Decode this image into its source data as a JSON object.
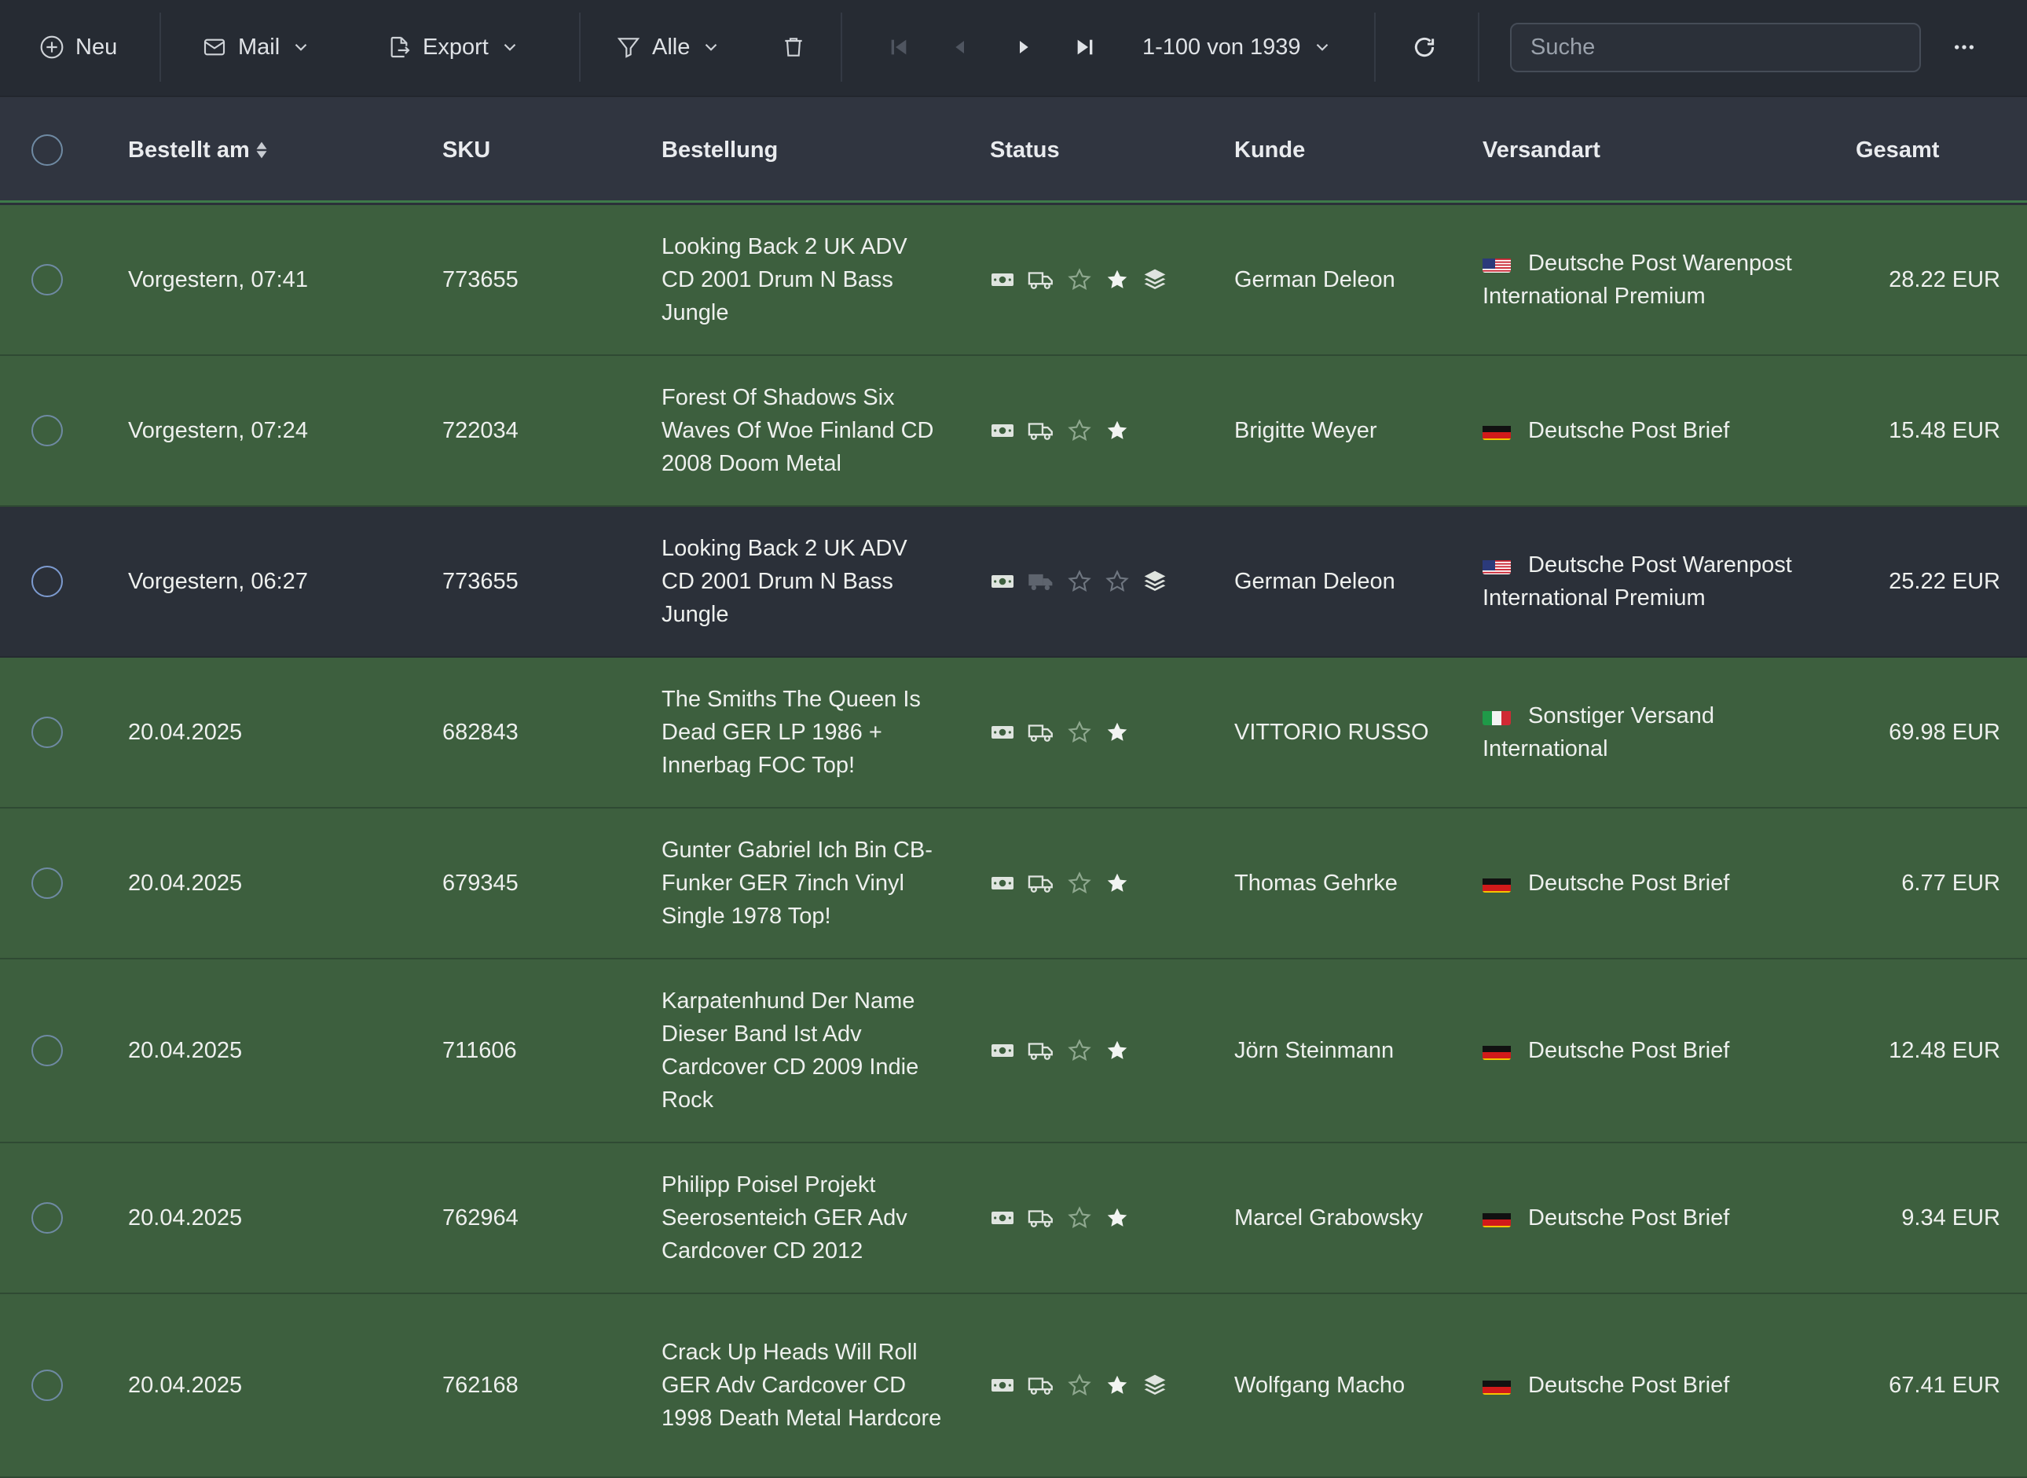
{
  "toolbar": {
    "new_label": "Neu",
    "mail_label": "Mail",
    "export_label": "Export",
    "filter_label": "Alle",
    "pagination_label": "1-100 von 1939",
    "search_placeholder": "Suche"
  },
  "table": {
    "columns": [
      "Bestellt am",
      "SKU",
      "Bestellung",
      "Status",
      "Kunde",
      "Versandart",
      "Gesamt"
    ],
    "rows": [
      {
        "date": "Vorgestern, 07:41",
        "sku": "773655",
        "order": "Looking Back 2 UK ADV CD 2001 Drum N Bass Jungle",
        "customer": "German Deleon",
        "flag": "us",
        "shipping": "Deutsche Post Warenpost International Premium",
        "total": "28.22 EUR",
        "highlighted": true,
        "truck_active": true,
        "star_filled": true,
        "stack": true
      },
      {
        "date": "Vorgestern, 07:24",
        "sku": "722034",
        "order": "Forest Of Shadows Six Waves Of Woe Finland CD 2008 Doom Metal",
        "customer": "Brigitte Weyer",
        "flag": "de",
        "shipping": "Deutsche Post Brief",
        "total": "15.48 EUR",
        "highlighted": true,
        "truck_active": true,
        "star_filled": true,
        "stack": false
      },
      {
        "date": "Vorgestern, 06:27",
        "sku": "773655",
        "order": "Looking Back 2 UK ADV CD 2001 Drum N Bass Jungle",
        "customer": "German Deleon",
        "flag": "us",
        "shipping": "Deutsche Post Warenpost International Premium",
        "total": "25.22 EUR",
        "highlighted": false,
        "truck_active": false,
        "star_filled": false,
        "stack": true
      },
      {
        "date": "20.04.2025",
        "sku": "682843",
        "order": "The Smiths The Queen Is Dead GER LP 1986 + Innerbag FOC Top!",
        "customer": "VITTORIO RUSSO",
        "flag": "it",
        "shipping": "Sonstiger Versand International",
        "total": "69.98 EUR",
        "highlighted": true,
        "truck_active": true,
        "star_filled": true,
        "stack": false
      },
      {
        "date": "20.04.2025",
        "sku": "679345",
        "order": "Gunter Gabriel Ich Bin CB-Funker GER 7inch Vinyl Single 1978 Top!",
        "customer": "Thomas Gehrke",
        "flag": "de",
        "shipping": "Deutsche Post Brief",
        "total": "6.77 EUR",
        "highlighted": true,
        "truck_active": true,
        "star_filled": true,
        "stack": false
      },
      {
        "date": "20.04.2025",
        "sku": "711606",
        "order": "Karpatenhund Der Name Dieser Band Ist Adv Cardcover CD 2009 Indie Rock",
        "customer": "Jörn Steinmann",
        "flag": "de",
        "shipping": "Deutsche Post Brief",
        "total": "12.48 EUR",
        "highlighted": true,
        "truck_active": true,
        "star_filled": true,
        "stack": false
      },
      {
        "date": "20.04.2025",
        "sku": "762964",
        "order": "Philipp Poisel Projekt Seerosenteich GER Adv Cardcover CD 2012",
        "customer": "Marcel Grabowsky",
        "flag": "de",
        "shipping": "Deutsche Post Brief",
        "total": "9.34 EUR",
        "highlighted": true,
        "truck_active": true,
        "star_filled": true,
        "stack": false
      },
      {
        "date": "20.04.2025",
        "sku": "762168",
        "order": "Crack Up Heads Will Roll GER Adv Cardcover CD 1998 Death Metal Hardcore",
        "customer": "Wolfgang Macho",
        "flag": "de",
        "shipping": "Deutsche Post Brief",
        "total": "67.41 EUR",
        "highlighted": true,
        "truck_active": true,
        "star_filled": true,
        "stack": true
      }
    ]
  },
  "colors": {
    "toolbar_bg": "#262b33",
    "header_bg": "#303540",
    "row_highlight": "#3d5f3e",
    "row_plain": "#2b3039",
    "accent_green": "#3e7a4a"
  }
}
